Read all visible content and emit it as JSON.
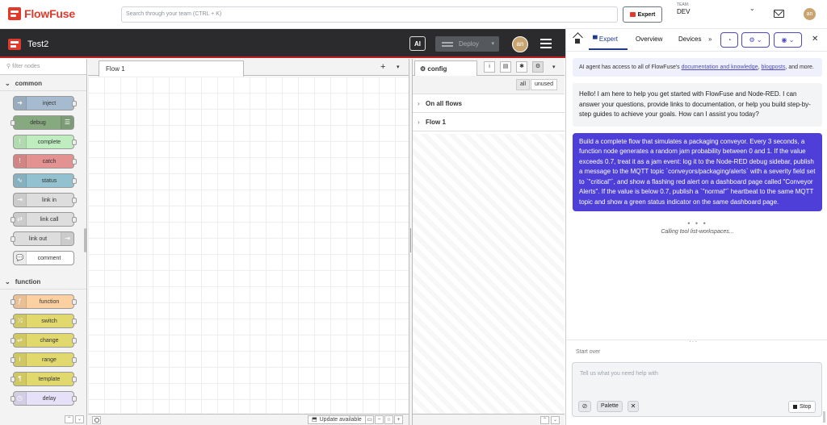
{
  "topbar": {
    "brand": "FlowFuse",
    "search_placeholder": "Search through your team (CTRL + K)",
    "expert_label": "Expert",
    "team_label": "TEAM:",
    "team_name": "DEV",
    "avatar_initials": "an"
  },
  "nodered": {
    "flow_title": "Test2",
    "ai_label": "AI",
    "deploy_label": "Deploy",
    "avatar_initials": "an"
  },
  "palette": {
    "filter_placeholder": "filter nodes",
    "categories": [
      {
        "name": "common",
        "nodes": [
          {
            "label": "inject",
            "color": "#a6bbcf",
            "icon": "arrow-right-icon",
            "glyph": "➜",
            "side": "left"
          },
          {
            "label": "debug",
            "color": "#87a980",
            "icon": "list-icon",
            "glyph": "☰",
            "side": "right"
          },
          {
            "label": "complete",
            "color": "#c0edc0",
            "icon": "exclamation-icon",
            "glyph": "!",
            "side": "left"
          },
          {
            "label": "catch",
            "color": "#e49191",
            "icon": "alert-icon",
            "glyph": "!",
            "side": "left"
          },
          {
            "label": "status",
            "color": "#94c1d0",
            "icon": "pulse-icon",
            "glyph": "∿",
            "side": "left"
          },
          {
            "label": "link in",
            "color": "#dddddd",
            "icon": "link-in-icon",
            "glyph": "⇥",
            "side": "left"
          },
          {
            "label": "link call",
            "color": "#dddddd",
            "icon": "link-call-icon",
            "glyph": "⇄",
            "side": "left"
          },
          {
            "label": "link out",
            "color": "#dddddd",
            "icon": "link-out-icon",
            "glyph": "⇥",
            "side": "right"
          },
          {
            "label": "comment",
            "color": "#ffffff",
            "icon": "comment-icon",
            "glyph": "💬",
            "side": "left"
          }
        ]
      },
      {
        "name": "function",
        "nodes": [
          {
            "label": "function",
            "color": "#fdd0a2",
            "icon": "function-icon",
            "glyph": "ƒ",
            "side": "left"
          },
          {
            "label": "switch",
            "color": "#e2d96e",
            "icon": "switch-icon",
            "glyph": "⤨",
            "side": "left"
          },
          {
            "label": "change",
            "color": "#e2d96e",
            "icon": "shuffle-icon",
            "glyph": "⇌",
            "side": "left"
          },
          {
            "label": "range",
            "color": "#e2d96e",
            "icon": "range-icon",
            "glyph": "i",
            "side": "left"
          },
          {
            "label": "template",
            "color": "#e2d96e",
            "icon": "template-icon",
            "glyph": "¶",
            "side": "left"
          },
          {
            "label": "delay",
            "color": "#e6e0f8",
            "icon": "timer-icon",
            "glyph": "◷",
            "side": "left"
          }
        ]
      }
    ]
  },
  "workspace": {
    "tab_label": "Flow 1",
    "update_label": "Update available"
  },
  "sidebar": {
    "tab_label": "config",
    "filter_all": "all",
    "filter_unused": "unused",
    "rows": [
      "On all flows",
      "Flow 1"
    ]
  },
  "expert": {
    "tabs": [
      "Expert",
      "Overview",
      "Devices"
    ],
    "info_prefix": "AI agent has access to all of FlowFuse's ",
    "info_link1": "documentation and knowledge",
    "info_sep": ", ",
    "info_link2": "blogposts",
    "info_suffix": ", and more.",
    "bot_message": "Hello! I am here to help you get started with FlowFuse and Node-RED. I can answer your questions, provide links to documentation, or help you build step-by-step guides to achieve your goals. How can I assist you today?",
    "user_message": "Build a complete flow that simulates a packaging conveyor. Every 3 seconds, a function node generates a random jam probability between 0 and 1. If the value exceeds 0.7, treat it as a jam event: log it to the Node-RED debug sidebar, publish a message to the MQTT topic `conveyors/packaging/alerts` with a severity field set to `\"critical\"`, and show a flashing red alert on a dashboard page called \"Conveyor Alerts\". If the value is below 0.7, publish a `\"normal\"` heartbeat to the same MQTT topic and show a green status indicator on the same dashboard page.",
    "status_dots": "• • •",
    "calling_text": "Calling tool list-workspaces...",
    "start_over": "Start over",
    "input_placeholder": "Tell us what you need help with",
    "palette_chip": "Palette",
    "stop_label": "Stop"
  },
  "colors": {
    "brand_red": "#e2392a",
    "expert_purple": "#4d3fd8",
    "nodered_header": "#2b2b2e"
  }
}
